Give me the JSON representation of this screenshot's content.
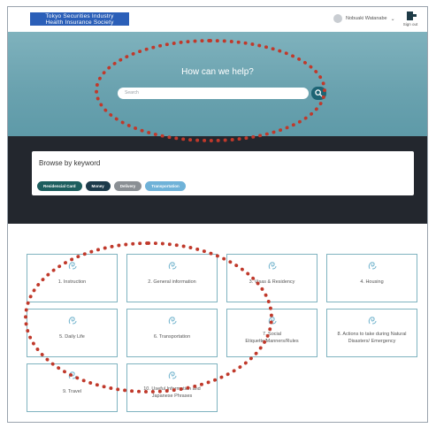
{
  "header": {
    "logo_line1": "Tokyo Securities Industry",
    "logo_line2": "Health Insurance Society",
    "user_name": "Nobuaki Watanabe",
    "caret": "⌄",
    "signout_label": "Sign out"
  },
  "hero": {
    "title": "How can we help?",
    "search_placeholder": "Search"
  },
  "browse": {
    "title": "Browse by keyword",
    "chips": [
      {
        "label": "Residencial Card",
        "color": "#1d5e5e"
      },
      {
        "label": "Money",
        "color": "#1d3b4b"
      },
      {
        "label": "Delivery",
        "color": "#8a8f94"
      },
      {
        "label": "Transportation",
        "color": "#6fb2d8"
      }
    ]
  },
  "categories": [
    {
      "label": "1. Instruction"
    },
    {
      "label": "2. General information"
    },
    {
      "label": "3. Visas & Residency"
    },
    {
      "label": "4. Housing"
    },
    {
      "label": "5. Daily Life"
    },
    {
      "label": "6. Transportation"
    },
    {
      "label": "7. Social Etiquette/Manners/Rules"
    },
    {
      "label": "8. Actions to take during Natural Disasters/ Emergency"
    },
    {
      "label": "9. Travel"
    },
    {
      "label": "10. Useful Information and Japanese Phrases"
    }
  ],
  "colors": {
    "accent": "#1d6474",
    "tile_border": "#7fb3c0",
    "annotation": "#c0392b"
  },
  "icons": {
    "category_icon": "swirl-logo-icon",
    "search_button_icon": "search-icon",
    "signout_icon": "signout-icon"
  }
}
